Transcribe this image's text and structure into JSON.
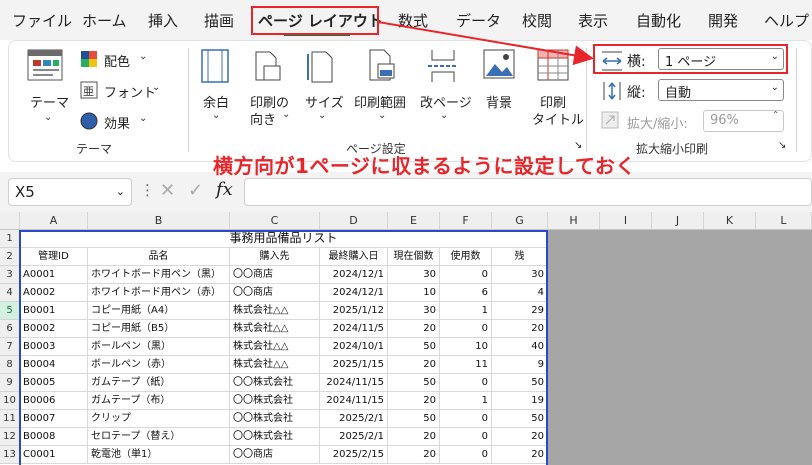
{
  "menu": {
    "tabs": [
      "ファイル",
      "ホーム",
      "挿入",
      "描画",
      "ページ レイアウト",
      "数式",
      "データ",
      "校閲",
      "表示",
      "自動化",
      "開発",
      "ヘルプ"
    ],
    "active": "ページ レイアウト"
  },
  "ribbon": {
    "theme": {
      "label": "テーマ",
      "colors": "配色",
      "fonts": "フォント",
      "effects": "効果",
      "group": "テーマ"
    },
    "page_setup": {
      "margins": "余白",
      "orientation": [
        "印刷の",
        "向き"
      ],
      "size": "サイズ",
      "print_area": "印刷範囲",
      "breaks": "改ページ",
      "background": "背景",
      "print_titles": [
        "印刷",
        "タイトル"
      ],
      "group": "ページ設定"
    },
    "scale": {
      "width_label": "横:",
      "width_value": "1 ページ",
      "height_label": "縦:",
      "height_value": "自動",
      "scale_label": "拡大/縮小:",
      "scale_value": "96%",
      "group": "拡大縮小印刷"
    }
  },
  "annotation": "横方向が1ページに収まるように設定しておく",
  "formula_bar": {
    "cell_ref": "X5",
    "fx": "fx"
  },
  "sheet": {
    "columns": [
      "A",
      "B",
      "C",
      "D",
      "E",
      "F",
      "G",
      "H",
      "I",
      "J",
      "K",
      "L"
    ],
    "rows": [
      "1",
      "2",
      "3",
      "4",
      "5",
      "6",
      "7",
      "8",
      "9",
      "10",
      "11",
      "12",
      "13"
    ],
    "title": "事務用品備品リスト",
    "headers": [
      "管理ID",
      "品名",
      "購入先",
      "最終購入日",
      "現在個数",
      "使用数",
      "残"
    ],
    "data": [
      [
        "A0001",
        "ホワイトボード用ペン（黒）",
        "〇〇商店",
        "2024/12/1",
        "30",
        "0",
        "30"
      ],
      [
        "A0002",
        "ホワイトボード用ペン（赤）",
        "〇〇商店",
        "2024/12/1",
        "10",
        "6",
        "4"
      ],
      [
        "B0001",
        "コピー用紙（A4）",
        "株式会社△△",
        "2025/1/12",
        "30",
        "1",
        "29"
      ],
      [
        "B0002",
        "コピー用紙（B5）",
        "株式会社△△",
        "2024/11/5",
        "20",
        "0",
        "20"
      ],
      [
        "B0003",
        "ボールペン（黒）",
        "株式会社△△",
        "2024/10/1",
        "50",
        "10",
        "40"
      ],
      [
        "B0004",
        "ボールペン（赤）",
        "株式会社△△",
        "2025/1/15",
        "20",
        "11",
        "9"
      ],
      [
        "B0005",
        "ガムテープ（紙）",
        "〇〇株式会社",
        "2024/11/15",
        "50",
        "0",
        "50"
      ],
      [
        "B0006",
        "ガムテープ（布）",
        "〇〇株式会社",
        "2024/11/15",
        "20",
        "1",
        "19"
      ],
      [
        "B0007",
        "クリップ",
        "〇〇株式会社",
        "2025/2/1",
        "50",
        "0",
        "50"
      ],
      [
        "B0008",
        "セロテープ（替え）",
        "〇〇株式会社",
        "2025/2/1",
        "20",
        "0",
        "20"
      ],
      [
        "C0001",
        "乾電池（単1）",
        "〇〇商店",
        "2025/2/15",
        "20",
        "0",
        "20"
      ]
    ]
  }
}
